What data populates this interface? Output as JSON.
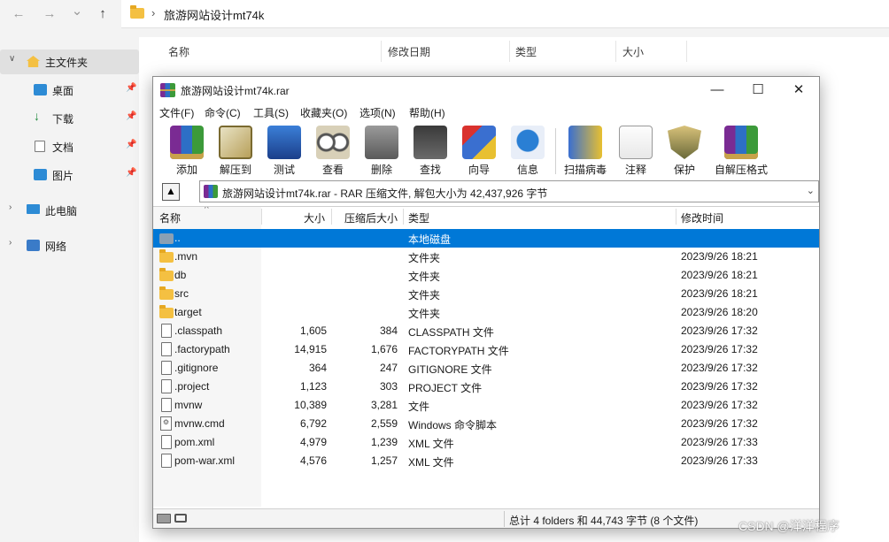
{
  "explorer": {
    "nav": {
      "back": "←",
      "forward": "→",
      "recent": "⌄",
      "up": "↑"
    },
    "address_path": "旅游网站设计mt74k",
    "address_sep": "›",
    "columns": [
      "名称",
      "修改日期",
      "类型",
      "大小"
    ],
    "sidebar": [
      {
        "label": "主文件夹",
        "icon": "home-icon"
      },
      {
        "label": "桌面",
        "icon": "desktop-icon"
      },
      {
        "label": "下载",
        "icon": "download-icon"
      },
      {
        "label": "文档",
        "icon": "document-icon"
      },
      {
        "label": "图片",
        "icon": "pictures-icon"
      },
      {
        "label": "此电脑",
        "icon": "computer-icon"
      },
      {
        "label": "网络",
        "icon": "network-icon"
      }
    ]
  },
  "rar": {
    "title": "旅游网站设计mt74k.rar",
    "window_buttons": {
      "minimize": "—",
      "maximize": "☐",
      "close": "✕"
    },
    "menu": [
      {
        "label": "文件(F)"
      },
      {
        "label": "命令(C)"
      },
      {
        "label": "工具(S)"
      },
      {
        "label": "收藏夹(O)"
      },
      {
        "label": "选项(N)"
      },
      {
        "label": "帮助(H)"
      }
    ],
    "toolbar": [
      {
        "label": "添加",
        "icon": "add-icon"
      },
      {
        "label": "解压到",
        "icon": "extract-icon"
      },
      {
        "label": "测试",
        "icon": "test-icon"
      },
      {
        "label": "查看",
        "icon": "view-icon"
      },
      {
        "label": "删除",
        "icon": "delete-icon"
      },
      {
        "label": "查找",
        "icon": "find-icon"
      },
      {
        "label": "向导",
        "icon": "wizard-icon"
      },
      {
        "label": "信息",
        "icon": "info-icon"
      },
      {
        "label": "扫描病毒",
        "icon": "scan-icon"
      },
      {
        "label": "注释",
        "icon": "comment-icon"
      },
      {
        "label": "保护",
        "icon": "protect-icon"
      },
      {
        "label": "自解压格式",
        "icon": "sfx-icon"
      }
    ],
    "up_button": "▲",
    "path_text": "旅游网站设计mt74k.rar - RAR 压缩文件, 解包大小为 42,437,926 字节",
    "path_dropdown": "⌄",
    "columns": {
      "name": "名称",
      "size": "大小",
      "packed": "压缩后大小",
      "type": "类型",
      "modified": "修改时间"
    },
    "files": [
      {
        "name": "..",
        "size": "",
        "packed": "",
        "type": "本地磁盘",
        "modified": "",
        "icon": "updir-icon",
        "selected": true
      },
      {
        "name": ".mvn",
        "size": "",
        "packed": "",
        "type": "文件夹",
        "modified": "2023/9/26 18:21",
        "icon": "folder-icon"
      },
      {
        "name": "db",
        "size": "",
        "packed": "",
        "type": "文件夹",
        "modified": "2023/9/26 18:21",
        "icon": "folder-icon"
      },
      {
        "name": "src",
        "size": "",
        "packed": "",
        "type": "文件夹",
        "modified": "2023/9/26 18:21",
        "icon": "folder-icon"
      },
      {
        "name": "target",
        "size": "",
        "packed": "",
        "type": "文件夹",
        "modified": "2023/9/26 18:20",
        "icon": "folder-icon"
      },
      {
        "name": ".classpath",
        "size": "1,605",
        "packed": "384",
        "type": "CLASSPATH 文件",
        "modified": "2023/9/26 17:32",
        "icon": "file-icon"
      },
      {
        "name": ".factorypath",
        "size": "14,915",
        "packed": "1,676",
        "type": "FACTORYPATH 文件",
        "modified": "2023/9/26 17:32",
        "icon": "file-icon"
      },
      {
        "name": ".gitignore",
        "size": "364",
        "packed": "247",
        "type": "GITIGNORE 文件",
        "modified": "2023/9/26 17:32",
        "icon": "file-icon"
      },
      {
        "name": ".project",
        "size": "1,123",
        "packed": "303",
        "type": "PROJECT 文件",
        "modified": "2023/9/26 17:32",
        "icon": "file-icon"
      },
      {
        "name": "mvnw",
        "size": "10,389",
        "packed": "3,281",
        "type": "文件",
        "modified": "2023/9/26 17:32",
        "icon": "file-icon"
      },
      {
        "name": "mvnw.cmd",
        "size": "6,792",
        "packed": "2,559",
        "type": "Windows 命令脚本",
        "modified": "2023/9/26 17:32",
        "icon": "script-icon"
      },
      {
        "name": "pom.xml",
        "size": "4,979",
        "packed": "1,239",
        "type": "XML 文件",
        "modified": "2023/9/26 17:33",
        "icon": "file-icon"
      },
      {
        "name": "pom-war.xml",
        "size": "4,576",
        "packed": "1,257",
        "type": "XML 文件",
        "modified": "2023/9/26 17:33",
        "icon": "file-icon"
      }
    ],
    "status_text": "总计 4 folders 和 44,743 字节 (8 个文件)"
  },
  "watermark": "CSDN @洋洋程序"
}
